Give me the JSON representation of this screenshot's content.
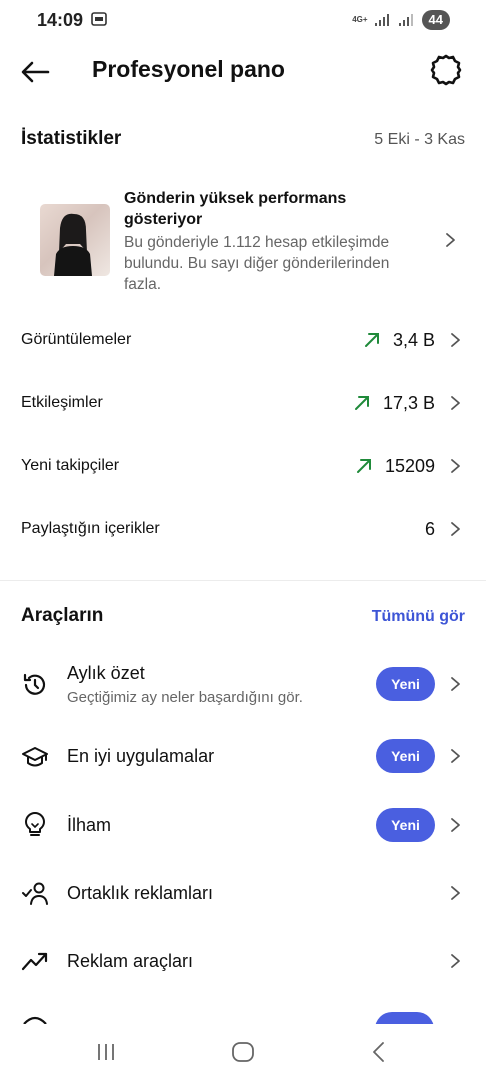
{
  "status_bar": {
    "time": "14:09",
    "network": "4G+",
    "battery": "44"
  },
  "header": {
    "title": "Profesyonel pano"
  },
  "stats_section": {
    "title": "İstatistikler",
    "date_range": "5 Eki - 3 Kas",
    "highlight": {
      "title": "Gönderin yüksek performans gösteriyor",
      "description": "Bu gönderiyle 1.112 hesap etkileşimde bulundu. Bu sayı diğer gönderilerinden fazla."
    },
    "rows": [
      {
        "label": "Görüntülemeler",
        "value": "3,4 B",
        "trend": "up"
      },
      {
        "label": "Etkileşimler",
        "value": "17,3 B",
        "trend": "up"
      },
      {
        "label": "Yeni takipçiler",
        "value": "15209",
        "trend": "up"
      },
      {
        "label": "Paylaştığın içerikler",
        "value": "6"
      }
    ]
  },
  "tools_section": {
    "title": "Araçların",
    "see_all": "Tümünü gör",
    "items": [
      {
        "label": "Aylık özet",
        "subtitle": "Geçtiğimiz ay neler başardığını gör.",
        "badge": "Yeni",
        "icon": "history-icon"
      },
      {
        "label": "En iyi uygulamalar",
        "badge": "Yeni",
        "icon": "graduation-cap-icon"
      },
      {
        "label": "İlham",
        "badge": "Yeni",
        "icon": "lightbulb-icon"
      },
      {
        "label": "Ortaklık reklamları",
        "icon": "partner-check-icon"
      },
      {
        "label": "Reklam araçları",
        "icon": "trending-up-icon"
      }
    ]
  },
  "colors": {
    "accent": "#4a5fe0",
    "link": "#3d55d6",
    "trend": "#1f8a3a"
  }
}
